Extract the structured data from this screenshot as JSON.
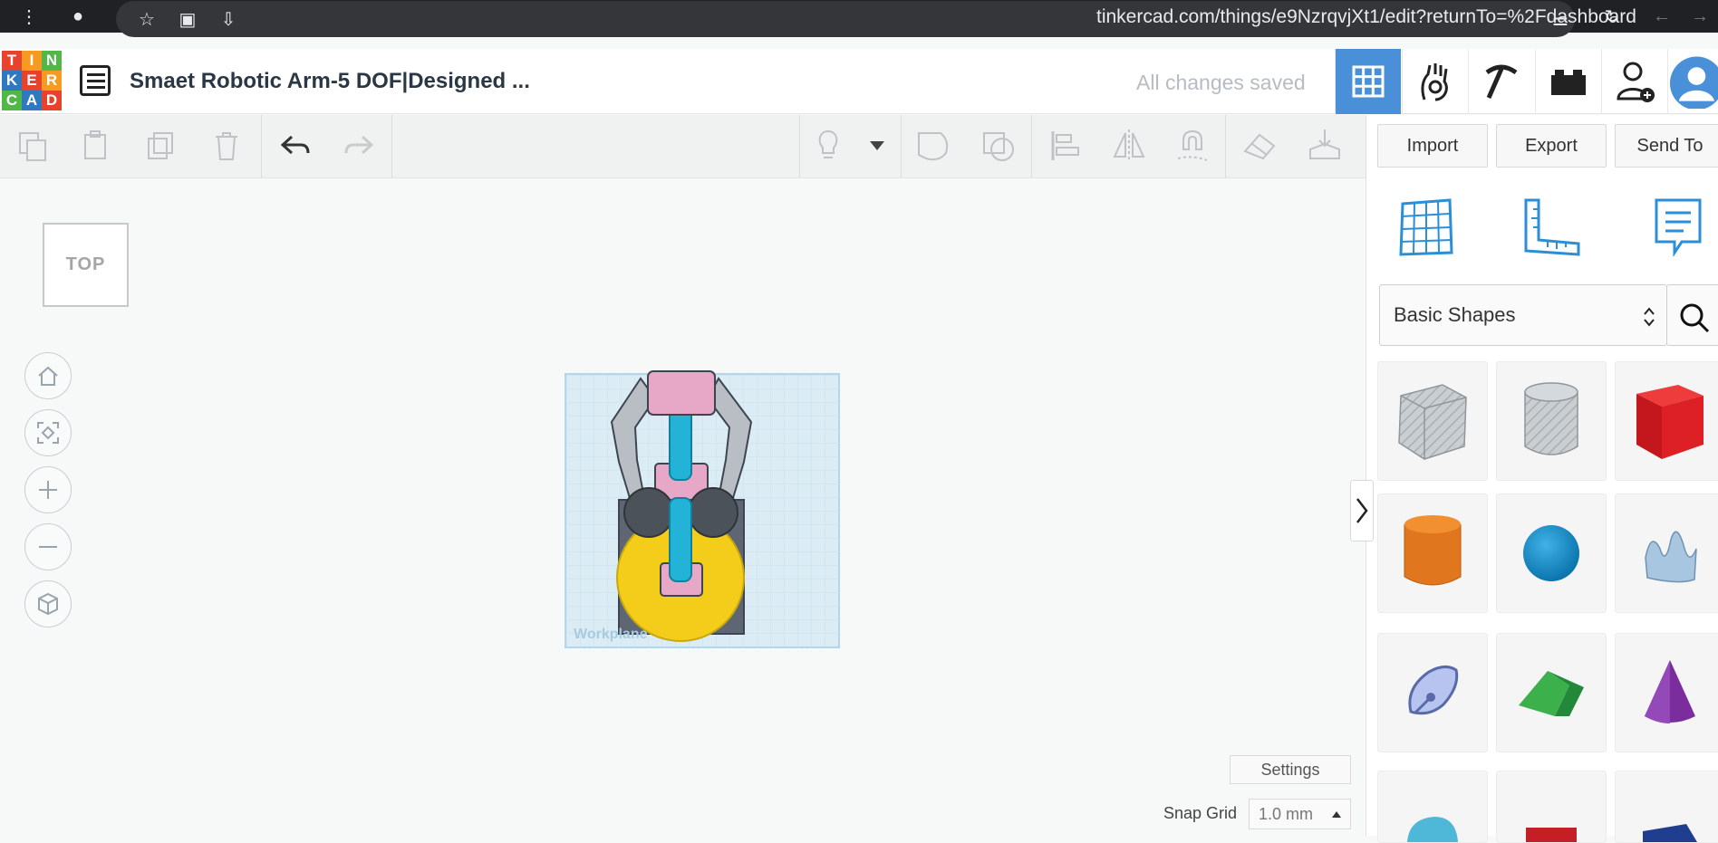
{
  "browser": {
    "url": "tinkercad.com/things/e9NzrqvjXt1/edit?returnTo=%2Fdashboard"
  },
  "app": {
    "logo_letters": [
      "T",
      "I",
      "N",
      "K",
      "E",
      "R",
      "C",
      "A",
      "D"
    ],
    "title": "Smaet Robotic Arm-5 DOF|Designed ...",
    "status": "All changes saved"
  },
  "toolbar": {
    "copy": "copy",
    "paste": "paste",
    "duplicate": "duplicate",
    "delete": "delete",
    "undo": "undo",
    "redo": "redo"
  },
  "panel": {
    "import_label": "Import",
    "export_label": "Export",
    "send_label": "Send To",
    "library": "Basic Shapes"
  },
  "viewport": {
    "viewcube_label": "TOP",
    "workplane_label": "Workplane"
  },
  "footer": {
    "settings_label": "Settings",
    "snap_label": "Snap Grid",
    "snap_value": "1.0 mm"
  },
  "colors": {
    "logo": [
      "#e8412c",
      "#f59b21",
      "#51b746",
      "#2f79c1",
      "#e8412c",
      "#f59b21",
      "#51b746",
      "#2f79c1",
      "#e8412c"
    ],
    "accent": "#4a90d9"
  }
}
